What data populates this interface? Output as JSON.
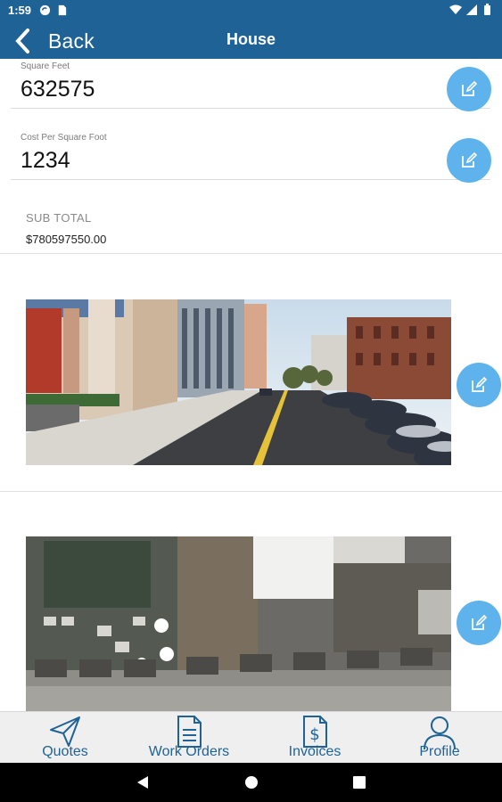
{
  "status_bar": {
    "time": "1:59"
  },
  "app_bar": {
    "back_label": "Back",
    "title": "House"
  },
  "fields": [
    {
      "label": "Square Feet",
      "value": "632575"
    },
    {
      "label": "Cost Per Square Foot",
      "value": "1234"
    }
  ],
  "subtotal": {
    "label": "SUB TOTAL",
    "value": "$780597550.00"
  },
  "bottom_nav": {
    "tabs": [
      {
        "label": "Quotes",
        "icon": "send-icon"
      },
      {
        "label": "Work Orders",
        "icon": "document-icon"
      },
      {
        "label": "Invoices",
        "icon": "invoice-dollar-icon"
      },
      {
        "label": "Profile",
        "icon": "person-icon"
      }
    ]
  },
  "colors": {
    "primary": "#1f6396",
    "fab": "#5fb3ec",
    "nav_bg": "#efefef"
  }
}
